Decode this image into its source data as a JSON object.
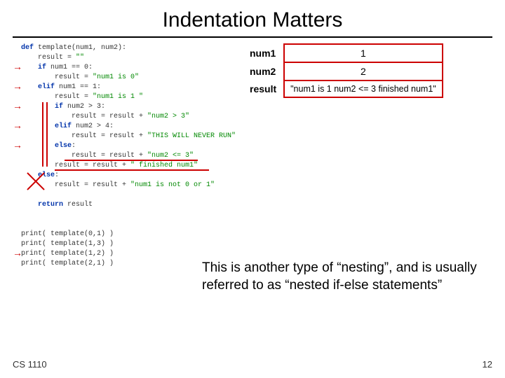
{
  "title": "Indentation Matters",
  "code": {
    "l0": "def template(num1, num2):",
    "l1": "    result = \"\"",
    "l2": "    if num1 == 0:",
    "l3": "        result = \"num1 is 0\"",
    "l4": "    elif num1 == 1:",
    "l5": "        result = \"num1 is 1 \"",
    "l6": "        if num2 > 3:",
    "l7": "            result = result + \"num2 > 3\"",
    "l8": "        elif num2 > 4:",
    "l9": "            result = result + \"THIS WILL NEVER RUN\"",
    "l10": "        else:",
    "l11": "            result = result + \"num2 <= 3\"",
    "l12": "        result = result + \" finished num1\"",
    "l13": "    else:",
    "l14": "        result = result + \"num1 is not 0 or 1\"",
    "l15": "",
    "l16": "    return result",
    "l17": "",
    "p0": "print( template(0,1) )",
    "p1": "print( template(1,3) )",
    "p2": "print( template(1,2) )",
    "p3": "print( template(2,1) )"
  },
  "trace": {
    "r1_label": "num1",
    "r1_val": "1",
    "r2_label": "num2",
    "r2_val": "2",
    "r3_label": "result",
    "r3_val": "\"num1 is 1 num2 <= 3 finished num1\""
  },
  "explain": "This is another type of “nesting”, and is usually referred to as “nested if-else statements”",
  "footer": {
    "course": "CS 1110",
    "page": "12"
  }
}
